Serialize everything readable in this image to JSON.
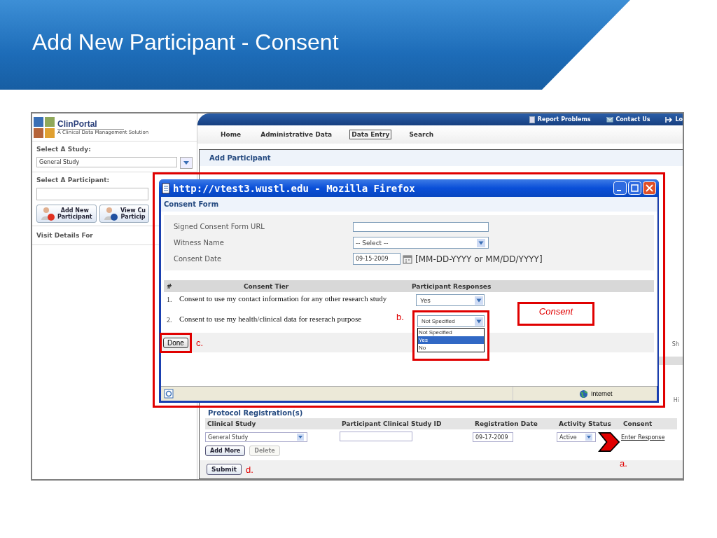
{
  "slide": {
    "title": "Add New Participant - Consent"
  },
  "app": {
    "logo": {
      "name": "ClinPortal",
      "tagline": "A Clinical Data Management Solution"
    },
    "top_links": [
      {
        "label": "Report Problems",
        "kind": "report"
      },
      {
        "label": "Contact Us",
        "kind": "mail"
      },
      {
        "label": "Lo",
        "kind": "logout"
      }
    ],
    "nav": [
      {
        "label": "Home",
        "selected": false
      },
      {
        "label": "Administrative Data",
        "selected": false
      },
      {
        "label": "Data Entry",
        "selected": true
      },
      {
        "label": "Search",
        "selected": false
      }
    ],
    "sidebar": {
      "study_label": "Select A Study:",
      "study_value": "General Study",
      "participant_label": "Select A Participant:",
      "buttons": [
        {
          "line1": "Add New",
          "line2": "Participant",
          "kind": "add"
        },
        {
          "line1": "View Cu",
          "line2": "Particip",
          "kind": "info"
        }
      ],
      "visit_details": "Visit Details For"
    },
    "main": {
      "heading": "Add Participant",
      "edge_labels": [
        "Sh",
        "Hi"
      ],
      "protocol_heading": "Protocol Registration(s)",
      "columns": [
        "Clinical Study",
        "Participant Clinical Study ID",
        "Registration Date",
        "Activity Status",
        "Consent"
      ],
      "row": {
        "clinical_study": "General Study",
        "registration_date": "09-17-2009",
        "activity_status": "Active",
        "consent_link": "Enter Response"
      },
      "add_more": {
        "label": "Add More",
        "disabled": false
      },
      "delete": {
        "label": "Delete",
        "disabled": true
      },
      "submit": "Submit"
    }
  },
  "popup": {
    "title": "http://vtest3.wustl.edu - Mozilla Firefox",
    "form_title": "Consent Form",
    "fields": [
      {
        "label": "Signed Consent Form URL",
        "kind": "text"
      },
      {
        "label": "Witness Name",
        "kind": "select",
        "value": "-- Select --"
      },
      {
        "label": "Consent Date",
        "kind": "date",
        "value": "09-15-2009",
        "hint": "[MM-DD-YYYY or MM/DD/YYYY]"
      }
    ],
    "columns": [
      "#",
      "Consent Tier",
      "Participant Responses"
    ],
    "tiers": [
      {
        "number": "1.",
        "text": "Consent to use my contact information for any other research study",
        "response": "Yes"
      },
      {
        "number": "2.",
        "text": "Consent to use my health/clinical data for reserach purpose",
        "response": "Not Specified",
        "options": [
          {
            "label": "Not Specified",
            "selected": false
          },
          {
            "label": "Yes",
            "selected": true
          },
          {
            "label": "No",
            "selected": false
          }
        ]
      }
    ],
    "done": "Done",
    "status": "Internet"
  },
  "annotations": {
    "a": "a.",
    "b": "b.",
    "c": "c.",
    "d": "d.",
    "consent": "Consent"
  }
}
